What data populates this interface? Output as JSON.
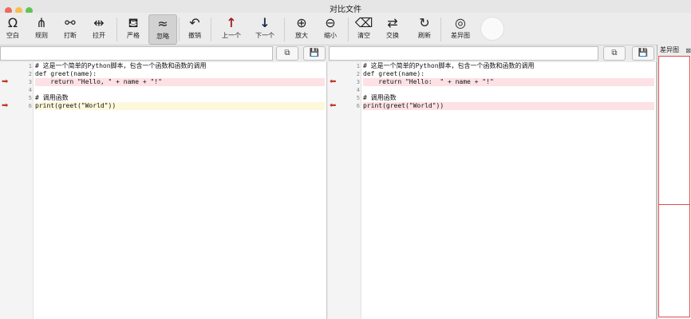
{
  "window": {
    "title": "对比文件"
  },
  "toolbar": {
    "buttons": [
      {
        "icon": "Ω",
        "label": "空白"
      },
      {
        "icon": "⋔",
        "label": "规则"
      },
      {
        "icon": "⚯",
        "label": "打断"
      },
      {
        "icon": "⇹",
        "label": "拉开"
      },
      {
        "icon": "⛾",
        "label": "严格"
      },
      {
        "icon": "≈",
        "label": "忽略"
      },
      {
        "icon": "↶",
        "label": "撤销"
      },
      {
        "icon": "↑",
        "label": "上一个"
      },
      {
        "icon": "↓",
        "label": "下一个"
      },
      {
        "icon": "⊕",
        "label": "放大"
      },
      {
        "icon": "⊖",
        "label": "缩小"
      },
      {
        "icon": "⌫",
        "label": "清空"
      },
      {
        "icon": "⇄",
        "label": "交换"
      },
      {
        "icon": "↻",
        "label": "刷新"
      },
      {
        "icon": "◎",
        "label": "差异图"
      }
    ]
  },
  "left": {
    "path": "",
    "lines": [
      {
        "num": "1",
        "text": "# 这是一个简单的Python脚本，包含一个函数和函数的调用"
      },
      {
        "num": "2",
        "text": "def greet(name):"
      },
      {
        "num": "3",
        "text": "    return \"Hello, \" + name + \"!\""
      },
      {
        "num": "4",
        "text": ""
      },
      {
        "num": "5",
        "text": "# 调用函数"
      },
      {
        "num": "6",
        "text": "print(greet(\"World\"))"
      }
    ]
  },
  "right": {
    "path": "",
    "lines": [
      {
        "num": "1",
        "text": "# 这是一个简单的Python脚本，包含一个函数和函数的调用"
      },
      {
        "num": "2",
        "text": "def greet(name):"
      },
      {
        "num": "3",
        "text": "    return \"Hello:  \" + name + \"!\""
      },
      {
        "num": "4",
        "text": ""
      },
      {
        "num": "5",
        "text": "# 调用函数"
      },
      {
        "num": "6",
        "text": "print(greet(\"World\"))"
      }
    ]
  },
  "diffmap": {
    "title": "差异图",
    "close": "⊠"
  },
  "icons": {
    "arrow_right": "➡",
    "arrow_left": "⬅",
    "copy": "⧉",
    "save": "💾"
  },
  "colors": {
    "changed": "#fde1e4",
    "current": "#fdf7dc",
    "arrow": "#c0392b"
  }
}
